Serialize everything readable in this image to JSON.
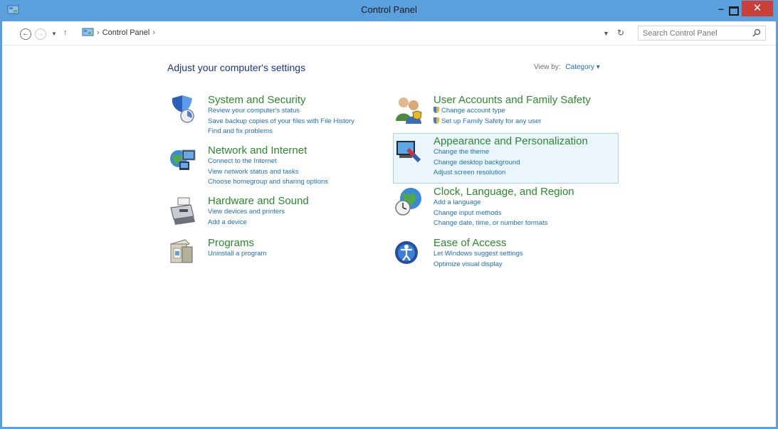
{
  "window": {
    "title": "Control Panel"
  },
  "address": {
    "breadcrumb": [
      "Control Panel"
    ],
    "search_placeholder": "Search Control Panel"
  },
  "main": {
    "heading": "Adjust your computer's settings",
    "view_by_label": "View by:",
    "view_by_value": "Category"
  },
  "categories": [
    {
      "title": "System and Security",
      "icon": "system-security-icon",
      "links": [
        "Review your computer's status",
        "Save backup copies of your files with File History",
        "Find and fix problems"
      ]
    },
    {
      "title": "Network and Internet",
      "icon": "network-internet-icon",
      "links": [
        "Connect to the Internet",
        "View network status and tasks",
        "Choose homegroup and sharing options"
      ]
    },
    {
      "title": "Hardware and Sound",
      "icon": "hardware-sound-icon",
      "links": [
        "View devices and printers",
        "Add a device"
      ]
    },
    {
      "title": "Programs",
      "icon": "programs-icon",
      "links": [
        "Uninstall a program"
      ]
    },
    {
      "title": "User Accounts and Family Safety",
      "icon": "user-accounts-icon",
      "links": [
        "Change account type",
        "Set up Family Safety for any user"
      ]
    },
    {
      "title": "Appearance and Personalization",
      "icon": "appearance-icon",
      "links": [
        "Change the theme",
        "Change desktop background",
        "Adjust screen resolution"
      ]
    },
    {
      "title": "Clock, Language, and Region",
      "icon": "clock-globe-icon",
      "links": [
        "Add a language",
        "Change input methods",
        "Change date, time, or number formats"
      ]
    },
    {
      "title": "Ease of Access",
      "icon": "ease-of-access-icon",
      "links": [
        "Let Windows suggest settings",
        "Optimize visual display"
      ]
    }
  ],
  "colors": {
    "titlebar": "#5aa0dc",
    "category_title": "#2b8a2d",
    "link": "#1e6fb8",
    "heading": "#1e3287",
    "close_button": "#c7403a",
    "hover_highlight": "#eaf6fc"
  }
}
